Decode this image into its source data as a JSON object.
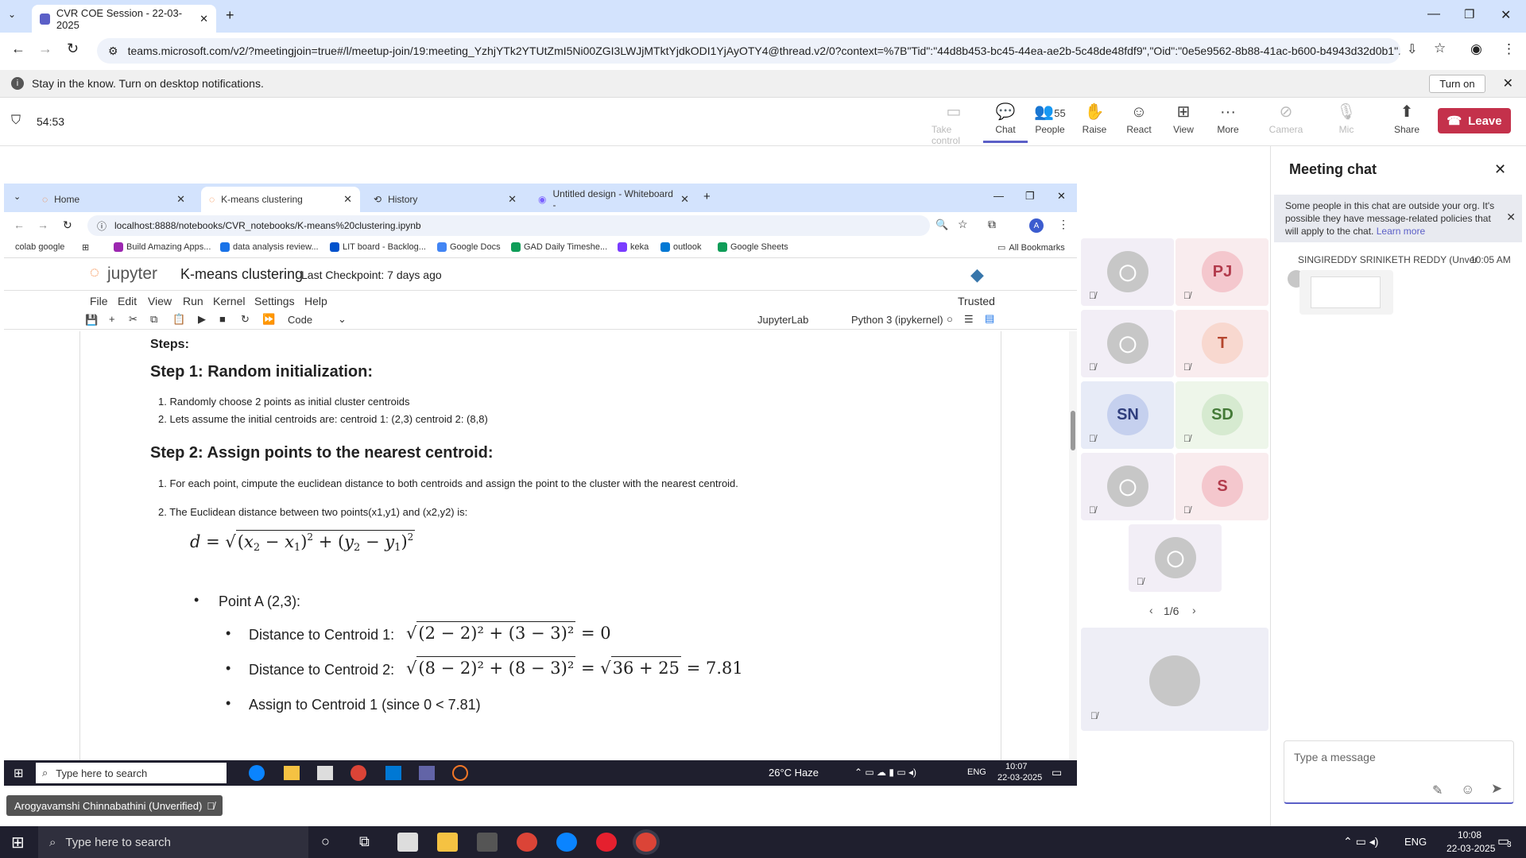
{
  "browser": {
    "tab_title": "CVR COE Session - 22-03-2025",
    "url": "teams.microsoft.com/v2/?meetingjoin=true#/l/meetup-join/19:meeting_YzhjYTk2YTUtZmI5Ni00ZGI3LWJjMTktYjdkODI1YjAyOTY4@thread.v2/0?context=%7B\"Tid\":\"44d8b453-bc45-44ea-ae2b-5c48de48fdf9\",\"Oid\":\"0e5e9562-8b88-41ac-b600-b4943d32d0b1\"...",
    "notification": "Stay in the know. Turn on desktop notifications.",
    "turn_on": "Turn on"
  },
  "meeting": {
    "timer": "54:53",
    "toolbar": {
      "take_control": "Take control",
      "chat": "Chat",
      "people": "People",
      "people_count": "55",
      "raise": "Raise",
      "react": "React",
      "view": "View",
      "more": "More",
      "camera": "Camera",
      "mic": "Mic",
      "share": "Share",
      "leave": "Leave"
    }
  },
  "shared": {
    "tabs": [
      "Home",
      "K-means clustering",
      "History",
      "Untitled design - Whiteboard -"
    ],
    "url": "localhost:8888/notebooks/CVR_notebooks/K-means%20clustering.ipynb",
    "bookmarks": [
      "colab google",
      "Build Amazing Apps...",
      "data analysis review...",
      "LIT board - Backlog...",
      "Google Docs",
      "GAD Daily Timeshe...",
      "keka",
      "outlook",
      "Google Sheets",
      "All Bookmarks"
    ],
    "jupyter": {
      "logo": "jupyter",
      "title": "K-means clustering",
      "checkpoint": "Last Checkpoint: 7 days ago",
      "menus": [
        "File",
        "Edit",
        "View",
        "Run",
        "Kernel",
        "Settings",
        "Help"
      ],
      "trusted": "Trusted",
      "cell_type": "Code",
      "lab": "JupyterLab",
      "kernel": "Python 3 (ipykernel)"
    },
    "notebook": {
      "steps": "Steps:",
      "step1": "Step 1: Random initialization:",
      "step1_items": [
        "Randomly choose 2 points as initial cluster centroids",
        "Lets assume the initial centroids are: centroid 1: (2,3) centroid 2: (8,8)"
      ],
      "step2": "Step 2: Assign points to the nearest centroid:",
      "step2_items": [
        "For each point, cimpute the euclidean distance to both centroids and assign the point to the cluster with the nearest centroid.",
        "The Euclidean distance between two points(x1,y1) and (x2,y2) is:"
      ],
      "pointA": "Point A (2,3):",
      "d1_label": "Distance to Centroid 1:",
      "d1_expr": "(2 − 2)² + (3 − 3)²",
      "d1_result": "= 0",
      "d2_label": "Distance to Centroid 2:",
      "d2_expr": "(8 − 2)² + (8 − 3)²",
      "d2_mid": "= ",
      "d2_sqrt": "36 + 25",
      "d2_result": "= 7.81",
      "assign": "Assign to Centroid 1 (since 0 < 7.81)"
    },
    "taskbar": {
      "search": "Type here to search",
      "weather": "26°C Haze",
      "lang": "ENG",
      "time": "10:07",
      "date": "22-03-2025"
    }
  },
  "gallery": {
    "tiles": [
      "",
      "PJ",
      "",
      "T",
      "SN",
      "SD",
      "",
      "S",
      ""
    ],
    "page": "1/6"
  },
  "chat": {
    "title": "Meeting chat",
    "policy": "Some people in this chat are outside your org. It's possible they have message-related policies that will apply to the chat.",
    "learn_more": "Learn more",
    "sender": "SINGIREDDY SRINIKETH REDDY (Unver",
    "time": "10:05 AM",
    "placeholder": "Type a message"
  },
  "speaker": "Arogyavamshi Chinnabathini (Unverified)",
  "taskbar": {
    "search": "Type here to search",
    "lang": "ENG",
    "time": "10:08",
    "date": "22-03-2025",
    "notif_count": "3"
  },
  "colors": {
    "teams_accent": "#5b5fc7",
    "leave_red": "#c4314b",
    "tab_blue": "#d3e3fd"
  }
}
